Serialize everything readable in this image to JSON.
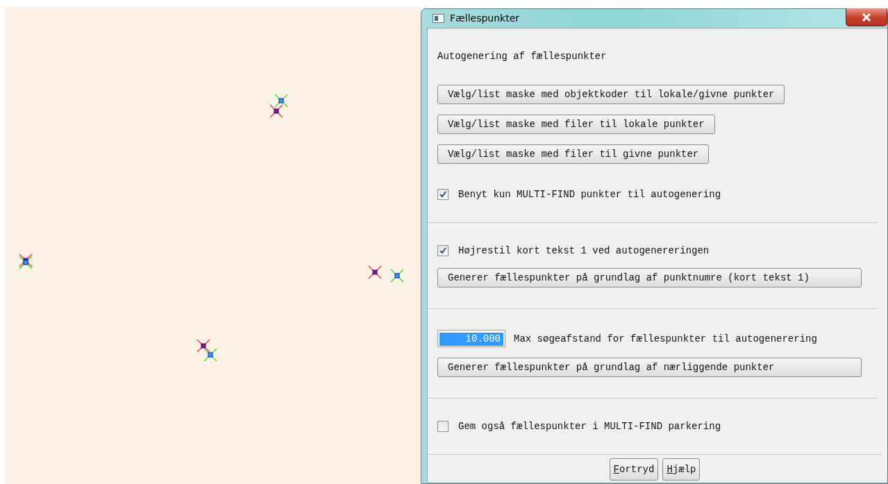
{
  "window": {
    "title": "Fællespunkter"
  },
  "sections": [
    {
      "items": [
        {
          "kind": "label",
          "text": "Autogenering af fællespunkter"
        },
        {
          "kind": "button",
          "label": "Vælg/list maske med objektkoder til lokale/givne punkter"
        },
        {
          "kind": "button",
          "label": "Vælg/list maske med filer til lokale punkter"
        },
        {
          "kind": "button",
          "label": "Vælg/list maske med filer til givne punkter"
        },
        {
          "kind": "checkbox",
          "label": "Benyt kun MULTI-FIND punkter til autogenering",
          "checked": true
        }
      ]
    },
    {
      "items": [
        {
          "kind": "checkbox",
          "label": "Højrestil kort tekst 1 ved autogenereringen",
          "checked": true
        },
        {
          "kind": "button",
          "label": "Generer fællespunkter på grundlag af punktnumre (kort tekst 1)",
          "wide": true
        }
      ]
    },
    {
      "items": [
        {
          "kind": "number",
          "value": "10.000",
          "label": "Max søgeafstand for fællespunkter til autogenerering"
        },
        {
          "kind": "button",
          "label": "Generer fællespunkter på grundlag af nærliggende punkter",
          "wide": true
        }
      ]
    },
    {
      "items": [
        {
          "kind": "checkbox",
          "label": "Gem også fællespunkter i MULTI-FIND parkering",
          "checked": false
        }
      ]
    }
  ],
  "footer_buttons": [
    {
      "label": "Fortryd",
      "underline_first_letter": true
    },
    {
      "label": "Hjælp",
      "underline_first_letter": true
    }
  ]
}
